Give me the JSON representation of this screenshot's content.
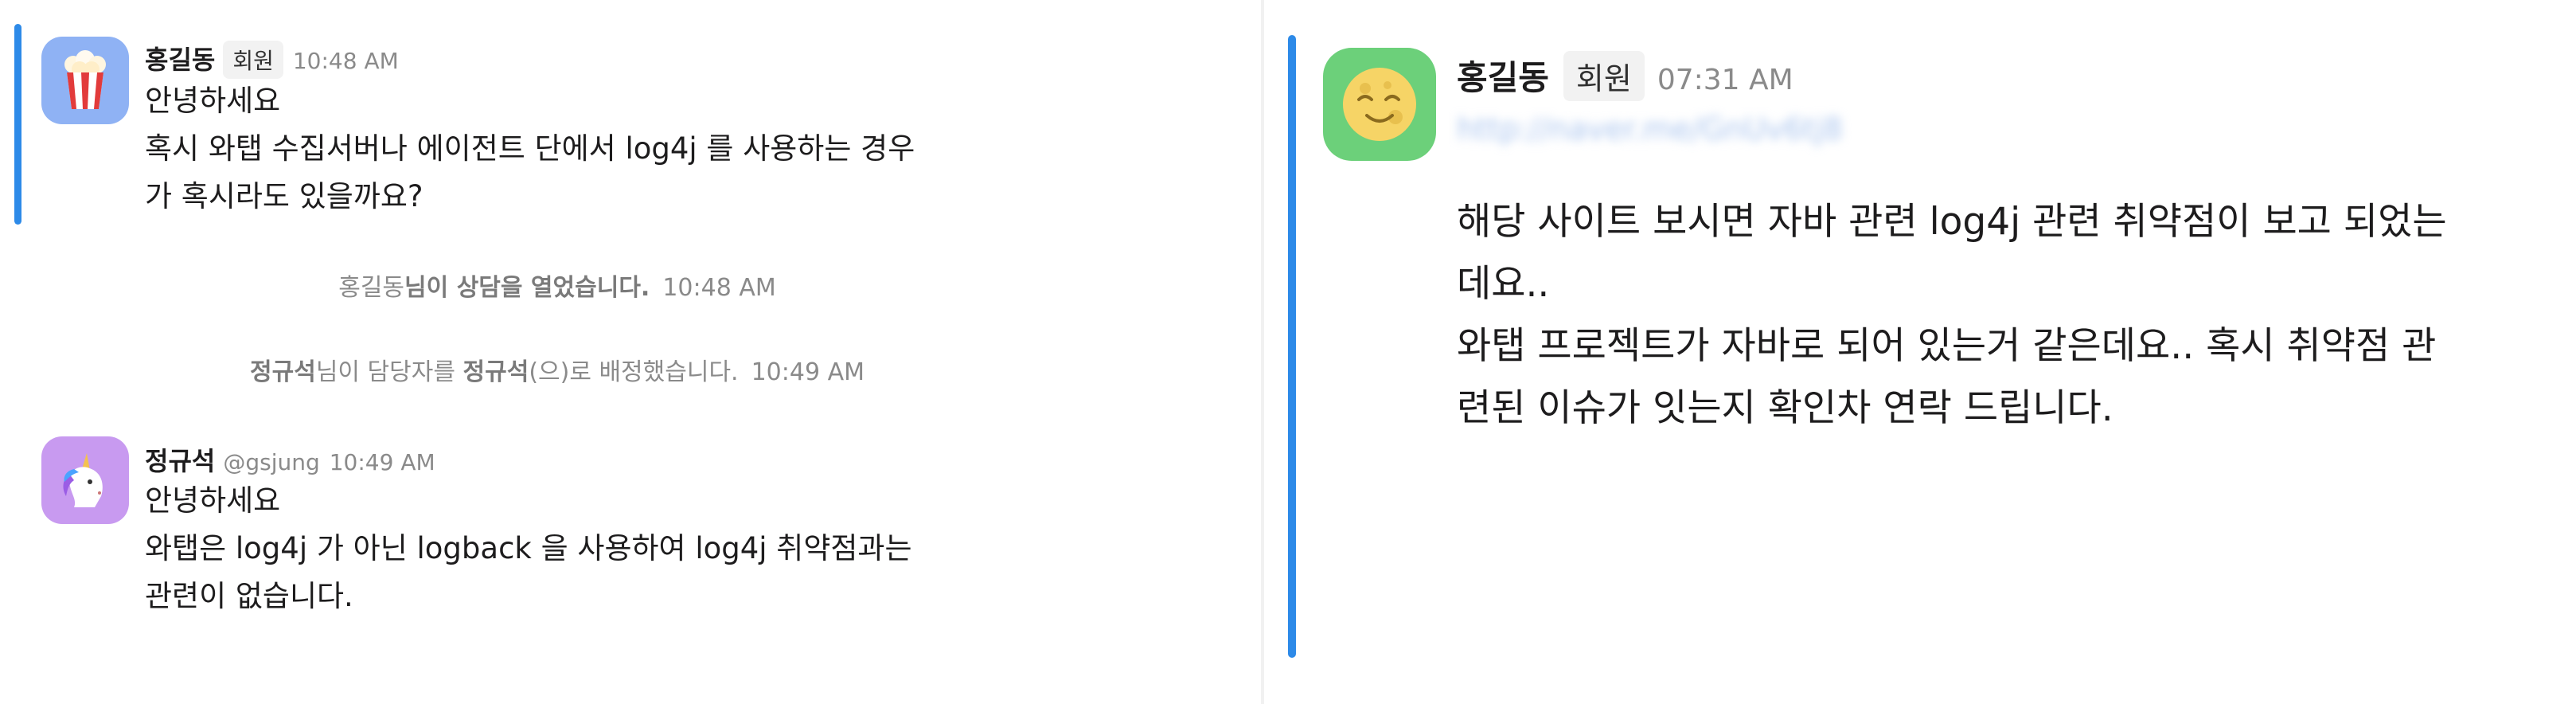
{
  "left": {
    "message1": {
      "author": "홍길동",
      "badge": "회원",
      "time": "10:48 AM",
      "avatar_icon": "popcorn-icon",
      "lines": [
        "안녕하세요",
        "혹시 와탭 수집서버나 에이전트 단에서 log4j 를 사용하는 경우",
        "가 혹시라도 있을까요?"
      ]
    },
    "system1": {
      "actor": "홍길동",
      "text": "님이 상담을 열었습니다.",
      "time": "10:48 AM"
    },
    "system2": {
      "actor": "정규석",
      "text1": "님이 담당자를 ",
      "assignee": "정규석",
      "text2": "(으)로 배정했습니다.",
      "time": "10:49 AM"
    },
    "message2": {
      "author": "정규석",
      "handle": "@gsjung",
      "time": "10:49 AM",
      "avatar_icon": "unicorn-icon",
      "lines": [
        "안녕하세요",
        "와탭은 log4j 가 아닌 logback 을 사용하여 log4j 취약점과는",
        "관련이 없습니다."
      ]
    }
  },
  "right": {
    "message": {
      "author": "홍길동",
      "badge": "회원",
      "time": "07:31 AM",
      "avatar_icon": "smiling-moon-icon",
      "link": "http://naver.me/GnUv6tj8",
      "lines": [
        "해당 사이트 보시면 자바 관련 log4j 관련 취약점이 보고 되었는",
        "데요..",
        "와탭 프로젝트가 자바로 되어 있는거 같은데요.. 혹시 취약점 관",
        "련된 이슈가 잇는지 확인차 연락 드립니다."
      ]
    }
  },
  "colors": {
    "accent": "#2d8ae8",
    "avatar_left1": "#8fb2f4",
    "avatar_left2": "#c89af0",
    "avatar_right": "#6cd07a",
    "muted": "#8a8a8a"
  }
}
